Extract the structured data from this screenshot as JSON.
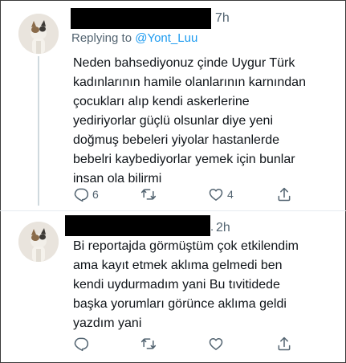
{
  "tweets": [
    {
      "time": "7h",
      "replying_prefix": "Replying to ",
      "replying_handle": "@Yont_Luu",
      "text": "Neden bahsediyonuz çinde Uygur Türk\nkadınlarının hamile olanlarının karnından\nçocukları alıp kendi askerlerine\nyediriyorlar güçlü olsunlar diye yeni\ndoğmuş bebeleri yiyolar hastanlerde\nbebelri kaybediyorlar yemek için bunlar\ninsan ola bilirmi",
      "reply_count": "6",
      "like_count": "4"
    },
    {
      "handle_tail": ".",
      "time": "2h",
      "text": "Bi reportajda görmüştüm çok etkilendim\nama kayıt etmek aklıma gelmedi ben\nkendi uydurmadım yani   Bu tıvitidede\nbaşka yorumları görünce aklıma geldi\nyazdım yani",
      "reply_count": "",
      "like_count": ""
    }
  ]
}
